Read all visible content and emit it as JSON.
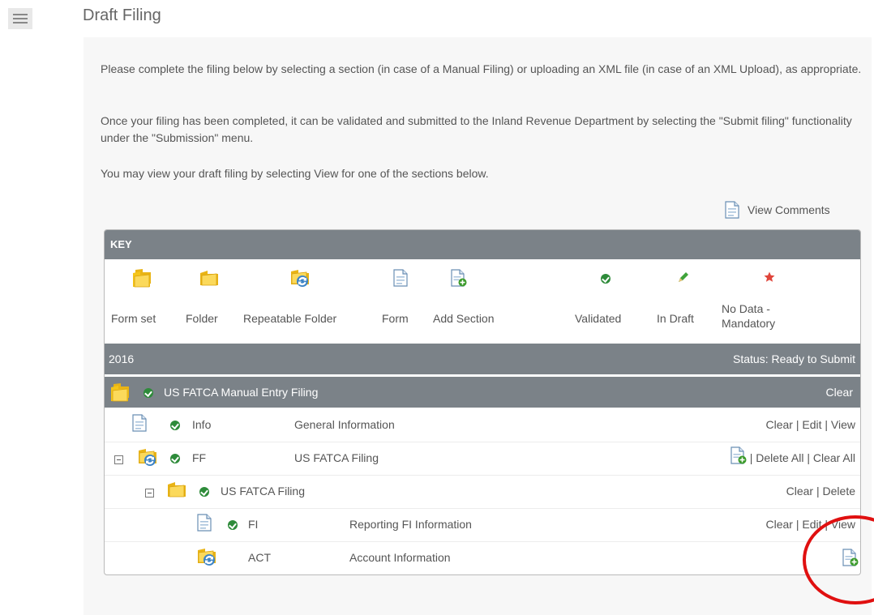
{
  "header": {
    "title": "Draft Filing",
    "menu_icon": "hamburger-icon"
  },
  "intro": {
    "p1": "Please complete the filing below by selecting a section (in case of a Manual Filing) or uploading an XML file (in case of an XML Upload), as appropriate.",
    "p2": "Once your filing has been completed, it can be validated and submitted to the Inland Revenue Department by selecting the \"Submit filing\" functionality under the \"Submission\" menu.",
    "p3": "You may view your draft filing by selecting View for one of the sections below."
  },
  "view_comments": {
    "label": "View Comments",
    "icon": "document-icon"
  },
  "key": {
    "title": "KEY",
    "items": [
      {
        "label": "Form set",
        "icon": "form-set-icon"
      },
      {
        "label": "Folder",
        "icon": "folder-icon"
      },
      {
        "label": "Repeatable Folder",
        "icon": "repeatable-folder-icon"
      },
      {
        "label": "Form",
        "icon": "form-icon"
      },
      {
        "label": "Add Section",
        "icon": "add-section-icon"
      },
      {
        "label": "Validated",
        "icon": "validated-icon"
      },
      {
        "label": "In Draft",
        "icon": "pencil-icon"
      },
      {
        "label": "No Data - Mandatory",
        "icon": "star-icon"
      }
    ]
  },
  "year_bar": {
    "year": "2016",
    "status": "Status: Ready to Submit"
  },
  "filing_header": {
    "title": "US FATCA Manual Entry Filing",
    "action": "Clear"
  },
  "rows": [
    {
      "code": "Info",
      "name": "General Information",
      "actions": [
        "Clear",
        "Edit",
        "View"
      ]
    },
    {
      "code": "FF",
      "name": "US FATCA Filing",
      "actions": [
        "Delete All",
        "Clear All"
      ]
    },
    {
      "code": "US FATCA Filing",
      "name": "",
      "actions": [
        "Clear",
        "Delete"
      ]
    },
    {
      "code": "FI",
      "name": "Reporting FI Information",
      "actions": [
        "Clear",
        "Edit",
        "View"
      ]
    },
    {
      "code": "ACT",
      "name": "Account Information",
      "actions": []
    }
  ],
  "colors": {
    "bar": "#7b8288",
    "validated": "#2e8b3a",
    "highlight": "#e01010",
    "folder": "#f5c518"
  }
}
